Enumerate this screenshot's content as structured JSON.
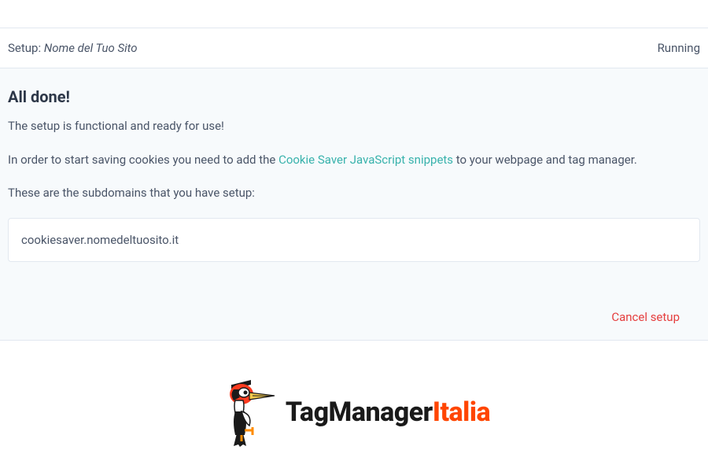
{
  "header": {
    "setup_label": "Setup: ",
    "site_name": "Nome del Tuo Sito",
    "status": "Running"
  },
  "main": {
    "heading": "All done!",
    "para1": "The setup is functional and ready for use!",
    "para2_prefix": "In order to start saving cookies you need to add the ",
    "para2_link": "Cookie Saver JavaScript snippets",
    "para2_suffix": " to your webpage and tag manager.",
    "para3": "These are the subdomains that you have setup:",
    "subdomain": "cookiesaver.nomedeltuosito.it",
    "cancel_label": "Cancel setup"
  },
  "logo": {
    "text_black": "TagManager",
    "text_orange": "Italia"
  }
}
